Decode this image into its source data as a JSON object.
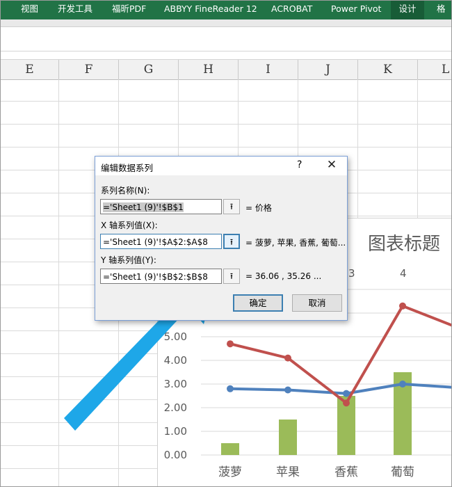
{
  "ribbon": {
    "tabs": [
      {
        "label": "视图",
        "active": false
      },
      {
        "label": "开发工具",
        "active": false
      },
      {
        "label": "福昕PDF",
        "active": false
      },
      {
        "label": "ABBYY FineReader 12",
        "active": false
      },
      {
        "label": "ACROBAT",
        "active": false
      },
      {
        "label": "Power Pivot",
        "active": false
      },
      {
        "label": "设计",
        "active": true
      },
      {
        "label": "格",
        "active": false
      }
    ]
  },
  "columns": [
    "E",
    "F",
    "G",
    "H",
    "I",
    "J",
    "K",
    "L"
  ],
  "dialog": {
    "title": "编辑数据系列",
    "help": "?",
    "series_name_label": "系列名称(N):",
    "series_name_value": "='Sheet1 (9)'!$B$1",
    "series_name_preview": "= 价格",
    "x_label": "X 轴系列值(X):",
    "x_value": "='Sheet1 (9)'!$A$2:$A$8",
    "x_preview": "= 菠萝, 苹果, 香蕉, 葡萄...",
    "y_label": "Y 轴系列值(Y):",
    "y_value": "='Sheet1 (9)'!$B$2:$B$8",
    "y_preview": "= 36.06 , 35.26 ...",
    "ok_label": "确定",
    "cancel_label": "取消",
    "ref_icon": "collapse-dialog-icon",
    "close_icon": "close-icon"
  },
  "chart": {
    "title": "图表标题",
    "top_labels": [
      "3",
      "4"
    ],
    "accent_arrow_color": "#1ea7e8"
  },
  "chart_data": {
    "type": "bar",
    "categories": [
      "菠萝",
      "苹果",
      "香蕉",
      "葡萄"
    ],
    "title": "图表标题",
    "y_ticks": [
      "0.00",
      "1.00",
      "2.00",
      "3.00",
      "4.00",
      "5.00"
    ],
    "ylim": [
      0,
      5
    ],
    "series": [
      {
        "type": "bar",
        "color": "#9bbb59",
        "values": [
          0.5,
          1.5,
          2.5,
          3.5
        ]
      },
      {
        "type": "line",
        "color": "#4f81bd",
        "values": [
          2.8,
          2.75,
          2.6,
          3.0
        ]
      },
      {
        "type": "line",
        "color": "#c0504d",
        "values": [
          4.7,
          4.1,
          2.2,
          6.3
        ]
      }
    ]
  }
}
